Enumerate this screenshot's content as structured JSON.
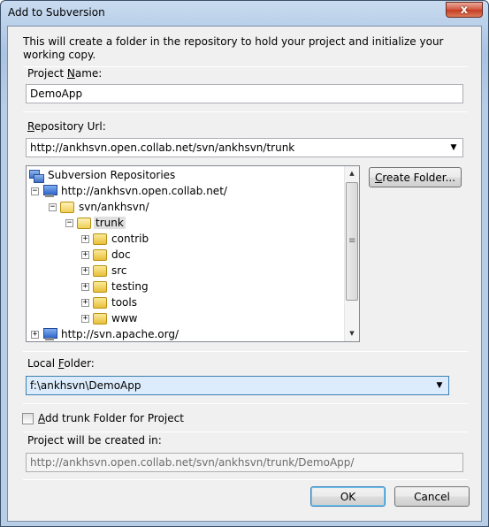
{
  "window": {
    "title": "Add to Subversion",
    "close_glyph": "x"
  },
  "intro_text": "This will create a folder in the repository to hold your project and initialize your working copy.",
  "project_name": {
    "label_pre": "Project ",
    "label_accel": "N",
    "label_post": "ame:",
    "value": "DemoApp"
  },
  "repository_url": {
    "label_pre": "",
    "label_accel": "R",
    "label_post": "epository Url:",
    "value": "http://ankhsvn.open.collab.net/svn/ankhsvn/trunk"
  },
  "tree": {
    "root": "Subversion Repositories",
    "server1": "http://ankhsvn.open.collab.net/",
    "repo_path": "svn/ankhsvn/",
    "selected": "trunk",
    "children": [
      "contrib",
      "doc",
      "src",
      "testing",
      "tools",
      "www"
    ],
    "server2": "http://svn.apache.org/"
  },
  "create_folder_button": {
    "label_pre": "",
    "label_accel": "C",
    "label_post": "reate Folder..."
  },
  "local_folder": {
    "label_pre": "Local ",
    "label_accel": "F",
    "label_post": "older:",
    "value": "f:\\ankhsvn\\DemoApp"
  },
  "add_trunk": {
    "label_pre": "",
    "label_accel": "A",
    "label_post": "dd trunk Folder for Project",
    "checked": false
  },
  "created_in": {
    "label": "Project will be created in:",
    "value": "http://ankhsvn.open.collab.net/svn/ankhsvn/trunk/DemoApp/"
  },
  "buttons": {
    "ok": "OK",
    "cancel": "Cancel"
  },
  "colors": {
    "titlebar": "#b9cfe9",
    "client_bg": "#f0f0f0",
    "focus_border": "#3c7fb1"
  }
}
